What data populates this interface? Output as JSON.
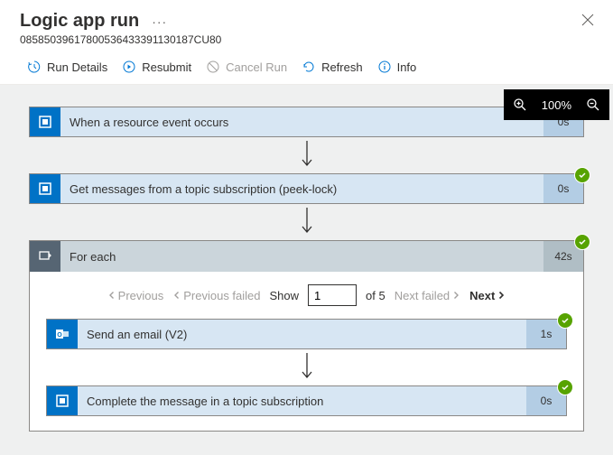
{
  "title": "Logic app run",
  "run_id": "08585039617800536433391130187CU80",
  "toolbar": {
    "run_details": "Run Details",
    "resubmit": "Resubmit",
    "cancel_run": "Cancel Run",
    "refresh": "Refresh",
    "info": "Info"
  },
  "zoom": {
    "percent": "100%"
  },
  "steps": {
    "trigger": {
      "label": "When a resource event occurs",
      "time": "0s"
    },
    "peek_lock": {
      "label": "Get messages from a topic subscription (peek-lock)",
      "time": "0s"
    },
    "foreach": {
      "label": "For each",
      "time": "42s",
      "pagination": {
        "previous": "Previous",
        "previous_failed": "Previous failed",
        "show": "Show",
        "current": "1",
        "of_label": "of 5",
        "next_failed": "Next failed",
        "next": "Next"
      },
      "children": {
        "send_email": {
          "label": "Send an email (V2)",
          "time": "1s"
        },
        "complete": {
          "label": "Complete the message in a topic subscription",
          "time": "0s"
        }
      }
    }
  }
}
